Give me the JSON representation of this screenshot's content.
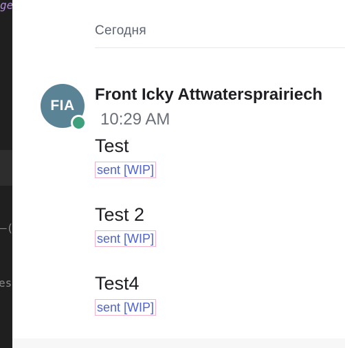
{
  "editor_strip": {
    "fragments": [
      "ge",
      "—(",
      "es"
    ]
  },
  "chat": {
    "date_separator": "Сегодня",
    "author": {
      "avatar_initials": "FIA",
      "name": "Front Icky Attwatersprairiech",
      "time": "10:29 AM",
      "presence": "online"
    },
    "messages": [
      {
        "text": "Test",
        "status": "sent [WIP]"
      },
      {
        "text": "Test 2",
        "status": "sent [WIP]"
      },
      {
        "text": "Test4",
        "status": "sent [WIP]"
      }
    ]
  },
  "colors": {
    "avatar_bg": "#5a8396",
    "presence_online": "#3fa07d",
    "status_text": "#4f63d2",
    "status_border": "#f1b3c8",
    "editor_bg": "#1f1f1f"
  }
}
